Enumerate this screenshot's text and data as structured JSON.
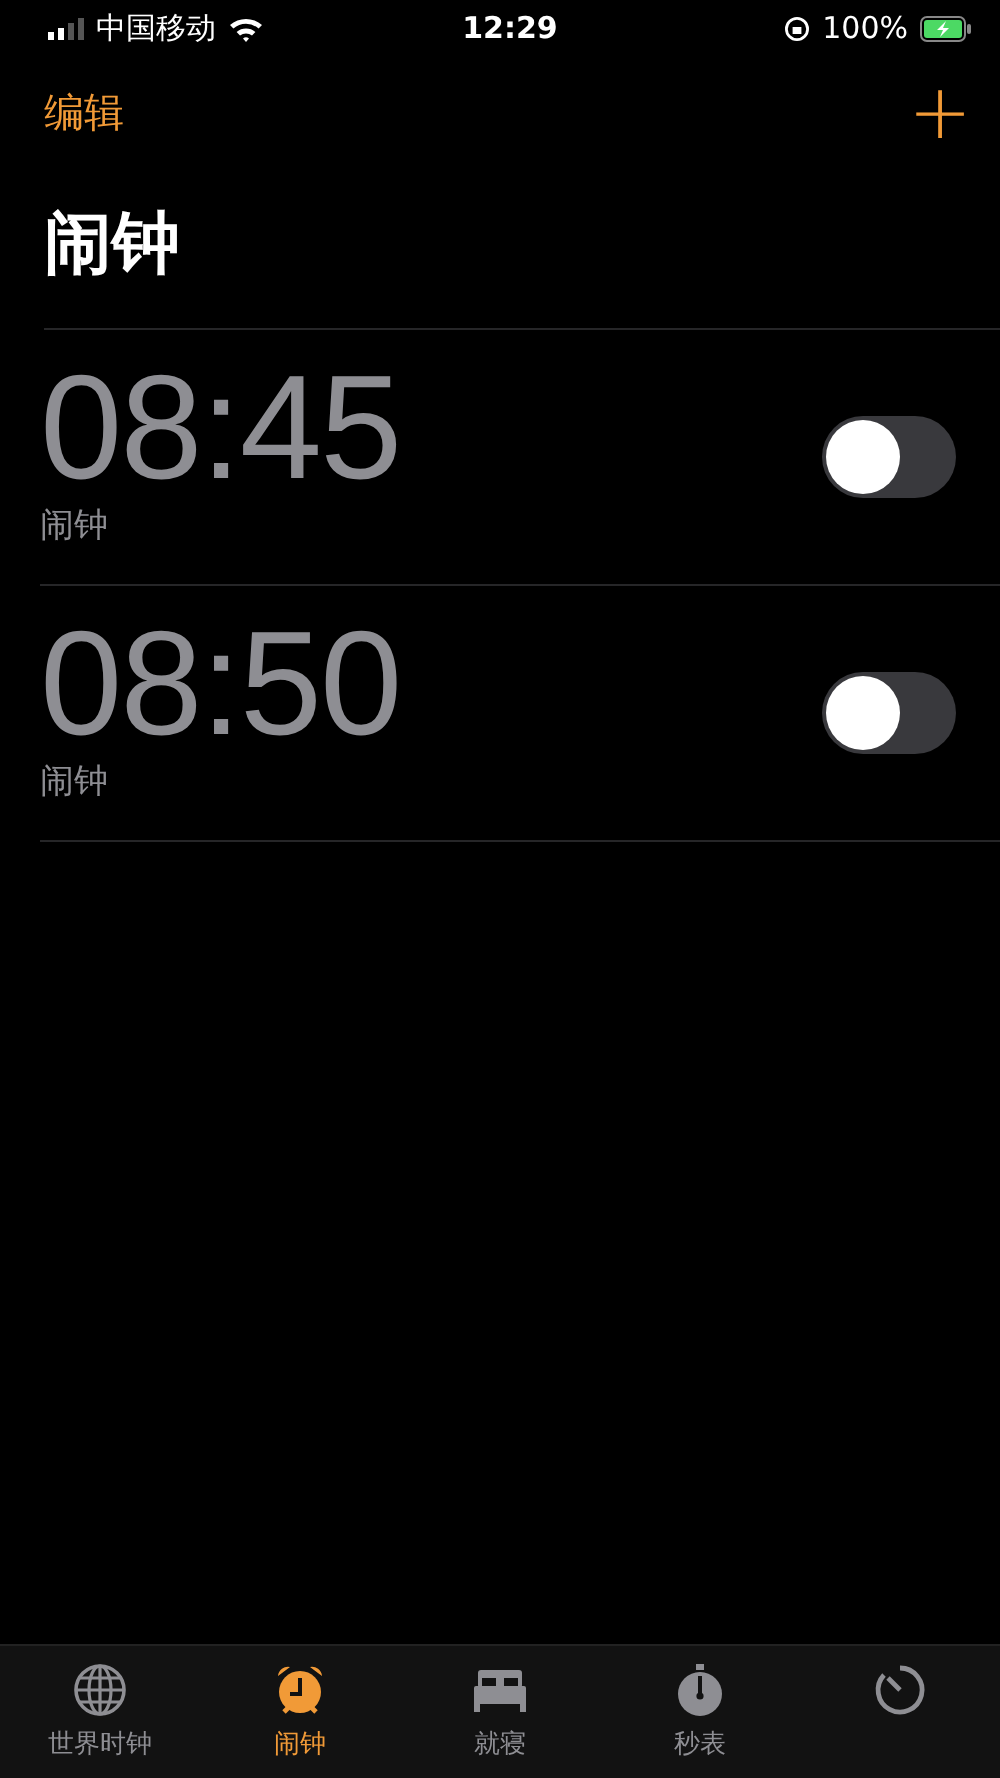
{
  "status_bar": {
    "carrier": "中国移动",
    "time": "12:29",
    "battery": "100%"
  },
  "nav": {
    "edit": "编辑",
    "add": "+"
  },
  "title": "闹钟",
  "alarms": [
    {
      "time": "08:45",
      "label": "闹钟",
      "on": false
    },
    {
      "time": "08:50",
      "label": "闹钟",
      "on": false
    }
  ],
  "tabs": [
    {
      "label": "世界时钟",
      "kind": "globe",
      "selected": false
    },
    {
      "label": "闹钟",
      "kind": "alarm",
      "selected": true
    },
    {
      "label": "就寝",
      "kind": "bed",
      "selected": false
    },
    {
      "label": "秒表",
      "kind": "stopwatch",
      "selected": false
    },
    {
      "kind": "timer",
      "selected": false
    }
  ]
}
